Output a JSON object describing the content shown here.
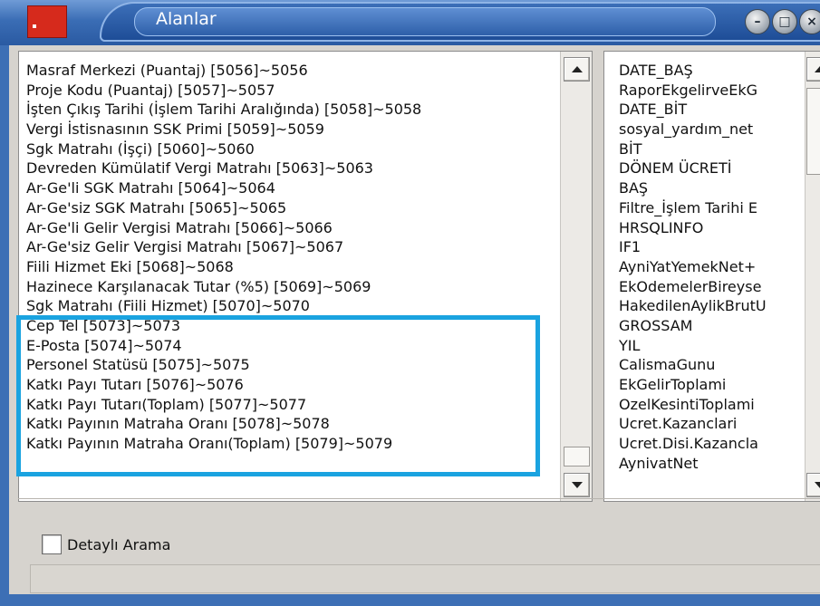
{
  "window": {
    "title": "Alanlar"
  },
  "left_list": {
    "items": [
      "Masraf Merkezi (Puantaj) [5056]~5056",
      "Proje Kodu (Puantaj) [5057]~5057",
      "İşten Çıkış Tarihi (İşlem Tarihi Aralığında) [5058]~5058",
      "Vergi İstisnasının SSK Primi [5059]~5059",
      "Sgk Matrahı (İşçi) [5060]~5060",
      "Devreden Kümülatif Vergi Matrahı [5063]~5063",
      "Ar-Ge'li SGK Matrahı [5064]~5064",
      "Ar-Ge'siz SGK Matrahı [5065]~5065",
      "Ar-Ge'li Gelir Vergisi Matrahı [5066]~5066",
      "Ar-Ge'siz Gelir Vergisi Matrahı [5067]~5067",
      "Fiili Hizmet Eki [5068]~5068",
      "Hazinece Karşılanacak Tutar (%5) [5069]~5069",
      "Sgk Matrahı (Fiili Hizmet) [5070]~5070",
      "Cep Tel [5073]~5073",
      "E-Posta [5074]~5074",
      "Personel Statüsü [5075]~5075",
      "Katkı Payı Tutarı [5076]~5076",
      "Katkı Payı Tutarı(Toplam) [5077]~5077",
      "Katkı Payının Matraha Oranı [5078]~5078",
      "Katkı Payının Matraha Oranı(Toplam) [5079]~5079"
    ]
  },
  "right_list": {
    "items": [
      "DATE_BAŞ",
      "RaporEkgelirveEkG",
      "DATE_BİT",
      "sosyal_yardım_net",
      "BİT",
      "DÖNEM ÜCRETİ",
      "BAŞ",
      "Filtre_İşlem Tarihi E",
      "HRSQLINFO",
      "IF1",
      "AyniYatYemekNet+",
      "EkOdemelerBireyse",
      "HakedilenAylikBrutU",
      "GROSSAM",
      "YIL",
      "CalismaGunu",
      "EkGelirToplami",
      "OzelKesintiToplami",
      "Ucret.Kazanclari",
      "Ucret.Disi.Kazancla",
      "AynivatNet"
    ]
  },
  "detail_search": {
    "label": "Detaylı Arama",
    "checked": false
  },
  "colors": {
    "highlight": "#1aa3e0",
    "titlebar": "#2a5aa2",
    "close_button_accent": "#d62a1c"
  }
}
